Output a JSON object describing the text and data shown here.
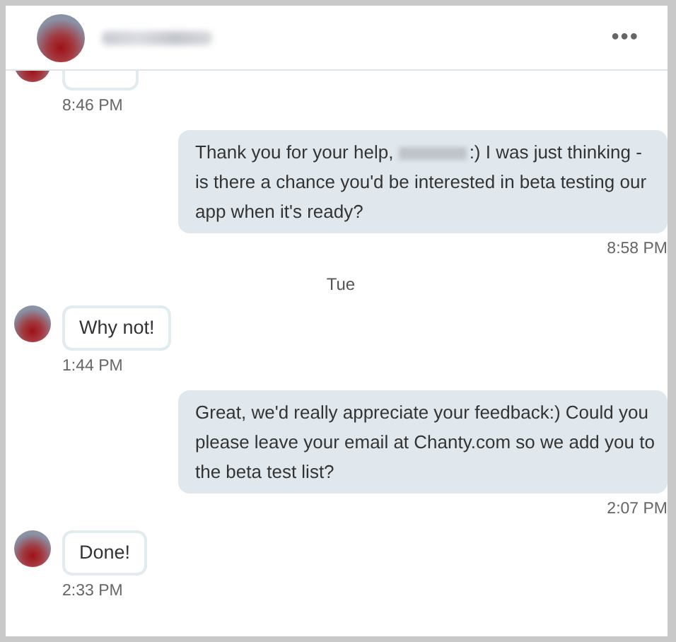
{
  "header": {
    "name_redacted": true,
    "menu": "•••"
  },
  "messages": [
    {
      "kind": "incoming",
      "time": "8:46 PM"
    },
    {
      "kind": "outgoing",
      "parts": [
        "Thank you for your help, ",
        ":) I was just thinking - is there a chance you'd be interested in beta testing our app when it's ready?"
      ],
      "redacted": true,
      "time": "8:58 PM"
    },
    {
      "kind": "day",
      "text": "Tue"
    },
    {
      "kind": "incoming",
      "text": "Why not!",
      "time": "1:44 PM"
    },
    {
      "kind": "outgoing",
      "parts": [
        "Great, we'd really appreciate your feedback:) Could you please leave your email at Chanty.com so we add you to the beta test list?"
      ],
      "redacted": false,
      "time": "2:07 PM"
    },
    {
      "kind": "incoming",
      "text": "Done!",
      "time": "2:33 PM"
    }
  ]
}
